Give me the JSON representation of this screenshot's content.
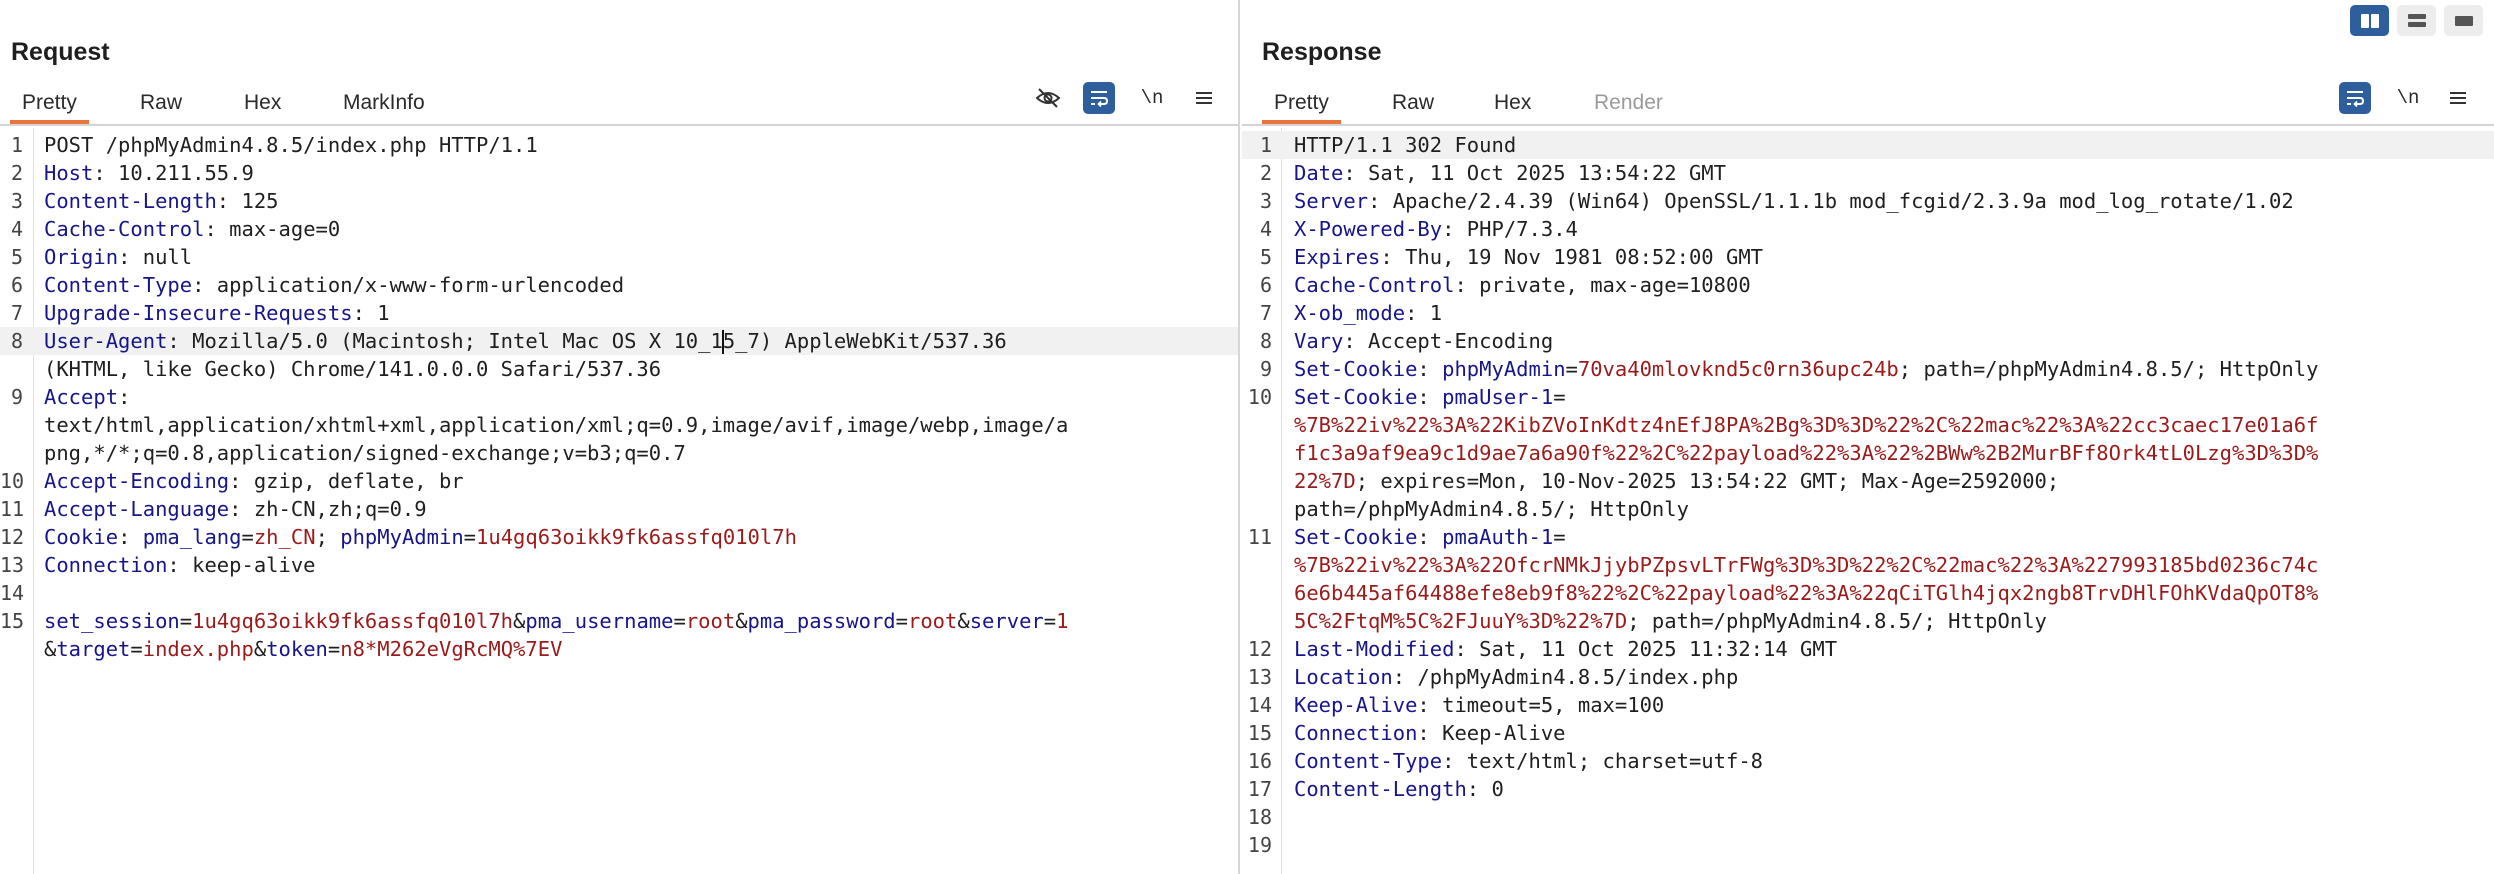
{
  "layout_switch": [
    "split-horizontal-icon",
    "split-vertical-icon",
    "tabs-view-icon"
  ],
  "request": {
    "title": "Request",
    "tabs": [
      "Pretty",
      "Raw",
      "Hex",
      "MarkInfo"
    ],
    "active_tab": "Pretty",
    "newline_toggle": "\\n",
    "lines": [
      {
        "n": "1",
        "segs": [
          {
            "t": "POST /phpMyAdmin4.8.5/index.php HTTP/1.1",
            "c": ""
          }
        ]
      },
      {
        "n": "2",
        "segs": [
          {
            "t": "Host",
            "c": "k"
          },
          {
            "t": ": 10.211.55.9",
            "c": ""
          }
        ]
      },
      {
        "n": "3",
        "segs": [
          {
            "t": "Content-Length",
            "c": "k"
          },
          {
            "t": ": 125",
            "c": ""
          }
        ]
      },
      {
        "n": "4",
        "segs": [
          {
            "t": "Cache-Control",
            "c": "k"
          },
          {
            "t": ": max-age=0",
            "c": ""
          }
        ]
      },
      {
        "n": "5",
        "segs": [
          {
            "t": "Origin",
            "c": "k"
          },
          {
            "t": ": null",
            "c": ""
          }
        ]
      },
      {
        "n": "6",
        "segs": [
          {
            "t": "Content-Type",
            "c": "k"
          },
          {
            "t": ": application/x-www-form-urlencoded",
            "c": ""
          }
        ]
      },
      {
        "n": "7",
        "segs": [
          {
            "t": "Upgrade-Insecure-Requests",
            "c": "k"
          },
          {
            "t": ": 1",
            "c": ""
          }
        ]
      },
      {
        "n": "8",
        "hl": true,
        "segs": [
          {
            "t": "User-Agent",
            "c": "k"
          },
          {
            "t": ": Mozilla/5.0 (Macintosh; Intel Mac OS X 10_1",
            "c": ""
          },
          {
            "caret": true
          },
          {
            "t": "5_7) AppleWebKit/537.36",
            "c": ""
          }
        ]
      },
      {
        "n": "",
        "segs": [
          {
            "t": "(KHTML, like Gecko) Chrome/141.0.0.0 Safari/537.36",
            "c": ""
          }
        ]
      },
      {
        "n": "9",
        "segs": [
          {
            "t": "Accept",
            "c": "k"
          },
          {
            "t": ":",
            "c": ""
          }
        ]
      },
      {
        "n": "",
        "segs": [
          {
            "t": "text/html,application/xhtml+xml,application/xml;q=0.9,image/avif,image/webp,image/a",
            "c": ""
          }
        ]
      },
      {
        "n": "",
        "segs": [
          {
            "t": "png,*/*;q=0.8,application/signed-exchange;v=b3;q=0.7",
            "c": ""
          }
        ]
      },
      {
        "n": "10",
        "segs": [
          {
            "t": "Accept-Encoding",
            "c": "k"
          },
          {
            "t": ": gzip, deflate, br",
            "c": ""
          }
        ]
      },
      {
        "n": "11",
        "segs": [
          {
            "t": "Accept-Language",
            "c": "k"
          },
          {
            "t": ": zh-CN,zh;q=0.9",
            "c": ""
          }
        ]
      },
      {
        "n": "12",
        "segs": [
          {
            "t": "Cookie",
            "c": "k"
          },
          {
            "t": ": ",
            "c": ""
          },
          {
            "t": "pma_lang",
            "c": "k"
          },
          {
            "t": "=",
            "c": ""
          },
          {
            "t": "zh_CN",
            "c": "v"
          },
          {
            "t": "; ",
            "c": ""
          },
          {
            "t": "phpMyAdmin",
            "c": "k"
          },
          {
            "t": "=",
            "c": ""
          },
          {
            "t": "1u4gq63oikk9fk6assfq010l7h",
            "c": "v"
          }
        ]
      },
      {
        "n": "13",
        "segs": [
          {
            "t": "Connection",
            "c": "k"
          },
          {
            "t": ": keep-alive",
            "c": ""
          }
        ]
      },
      {
        "n": "14",
        "segs": []
      },
      {
        "n": "15",
        "segs": [
          {
            "t": "set_session",
            "c": "k"
          },
          {
            "t": "=",
            "c": ""
          },
          {
            "t": "1u4gq63oikk9fk6assfq010l7h",
            "c": "v"
          },
          {
            "t": "&",
            "c": ""
          },
          {
            "t": "pma_username",
            "c": "k"
          },
          {
            "t": "=",
            "c": ""
          },
          {
            "t": "root",
            "c": "v"
          },
          {
            "t": "&",
            "c": ""
          },
          {
            "t": "pma_password",
            "c": "k"
          },
          {
            "t": "=",
            "c": ""
          },
          {
            "t": "root",
            "c": "v"
          },
          {
            "t": "&",
            "c": ""
          },
          {
            "t": "server",
            "c": "k"
          },
          {
            "t": "=",
            "c": ""
          },
          {
            "t": "1",
            "c": "v"
          }
        ]
      },
      {
        "n": "",
        "segs": [
          {
            "t": "&",
            "c": ""
          },
          {
            "t": "target",
            "c": "k"
          },
          {
            "t": "=",
            "c": ""
          },
          {
            "t": "index.php",
            "c": "v"
          },
          {
            "t": "&",
            "c": ""
          },
          {
            "t": "token",
            "c": "k"
          },
          {
            "t": "=",
            "c": ""
          },
          {
            "t": "n8*M262eVgRcMQ%7EV",
            "c": "v"
          }
        ]
      }
    ]
  },
  "response": {
    "title": "Response",
    "tabs": [
      "Pretty",
      "Raw",
      "Hex",
      "Render"
    ],
    "active_tab": "Pretty",
    "disabled_tab": "Render",
    "newline_toggle": "\\n",
    "lines": [
      {
        "n": "1",
        "hl": true,
        "segs": [
          {
            "t": "HTTP/1.1 302 Found",
            "c": ""
          }
        ]
      },
      {
        "n": "2",
        "segs": [
          {
            "t": "Date",
            "c": "k"
          },
          {
            "t": ": Sat, 11 Oct 2025 13:54:22 GMT",
            "c": ""
          }
        ]
      },
      {
        "n": "3",
        "segs": [
          {
            "t": "Server",
            "c": "k"
          },
          {
            "t": ": Apache/2.4.39 (Win64) OpenSSL/1.1.1b mod_fcgid/2.3.9a mod_log_rotate/1.02",
            "c": ""
          }
        ]
      },
      {
        "n": "4",
        "segs": [
          {
            "t": "X-Powered-By",
            "c": "k"
          },
          {
            "t": ": PHP/7.3.4",
            "c": ""
          }
        ]
      },
      {
        "n": "5",
        "segs": [
          {
            "t": "Expires",
            "c": "k"
          },
          {
            "t": ": Thu, 19 Nov 1981 08:52:00 GMT",
            "c": ""
          }
        ]
      },
      {
        "n": "6",
        "segs": [
          {
            "t": "Cache-Control",
            "c": "k"
          },
          {
            "t": ": private, max-age=10800",
            "c": ""
          }
        ]
      },
      {
        "n": "7",
        "segs": [
          {
            "t": "X-ob_mode",
            "c": "k"
          },
          {
            "t": ": 1",
            "c": ""
          }
        ]
      },
      {
        "n": "8",
        "segs": [
          {
            "t": "Vary",
            "c": "k"
          },
          {
            "t": ": Accept-Encoding",
            "c": ""
          }
        ]
      },
      {
        "n": "9",
        "segs": [
          {
            "t": "Set-Cookie",
            "c": "k"
          },
          {
            "t": ": ",
            "c": ""
          },
          {
            "t": "phpMyAdmin",
            "c": "k"
          },
          {
            "t": "=",
            "c": ""
          },
          {
            "t": "70va40mlovknd5c0rn36upc24b",
            "c": "v"
          },
          {
            "t": "; path=/phpMyAdmin4.8.5/; HttpOnly",
            "c": ""
          }
        ]
      },
      {
        "n": "10",
        "segs": [
          {
            "t": "Set-Cookie",
            "c": "k"
          },
          {
            "t": ": ",
            "c": ""
          },
          {
            "t": "pmaUser-1",
            "c": "k"
          },
          {
            "t": "=",
            "c": ""
          }
        ]
      },
      {
        "n": "",
        "segs": [
          {
            "t": "%7B%22iv%22%3A%22KibZVoInKdtz4nEfJ8PA%2Bg%3D%3D%22%2C%22mac%22%3A%22cc3caec17e01a6f",
            "c": "v"
          }
        ]
      },
      {
        "n": "",
        "segs": [
          {
            "t": "f1c3a9af9ea9c1d9ae7a6a90f%22%2C%22payload%22%3A%22%2BWw%2B2MurBFf8Ork4tL0Lzg%3D%3D%",
            "c": "v"
          }
        ]
      },
      {
        "n": "",
        "segs": [
          {
            "t": "22%7D",
            "c": "v"
          },
          {
            "t": "; expires=Mon, 10-Nov-2025 13:54:22 GMT; Max-Age=2592000;",
            "c": ""
          }
        ]
      },
      {
        "n": "",
        "segs": [
          {
            "t": "path=/phpMyAdmin4.8.5/; HttpOnly",
            "c": ""
          }
        ]
      },
      {
        "n": "11",
        "segs": [
          {
            "t": "Set-Cookie",
            "c": "k"
          },
          {
            "t": ": ",
            "c": ""
          },
          {
            "t": "pmaAuth-1",
            "c": "k"
          },
          {
            "t": "=",
            "c": ""
          }
        ]
      },
      {
        "n": "",
        "segs": [
          {
            "t": "%7B%22iv%22%3A%22OfcrNMkJjybPZpsvLTrFWg%3D%3D%22%2C%22mac%22%3A%227993185bd0236c74c",
            "c": "v"
          }
        ]
      },
      {
        "n": "",
        "segs": [
          {
            "t": "6e6b445af64488efe8eb9f8%22%2C%22payload%22%3A%22qCiTGlh4jqx2ngb8TrvDHlFOhKVdaQpOT8%",
            "c": "v"
          }
        ]
      },
      {
        "n": "",
        "segs": [
          {
            "t": "5C%2FtqM%5C%2FJuuY%3D%22%7D",
            "c": "v"
          },
          {
            "t": "; path=/phpMyAdmin4.8.5/; HttpOnly",
            "c": ""
          }
        ]
      },
      {
        "n": "12",
        "segs": [
          {
            "t": "Last-Modified",
            "c": "k"
          },
          {
            "t": ": Sat, 11 Oct 2025 11:32:14 GMT",
            "c": ""
          }
        ]
      },
      {
        "n": "13",
        "segs": [
          {
            "t": "Location",
            "c": "k"
          },
          {
            "t": ": /phpMyAdmin4.8.5/index.php",
            "c": ""
          }
        ]
      },
      {
        "n": "14",
        "segs": [
          {
            "t": "Keep-Alive",
            "c": "k"
          },
          {
            "t": ": timeout=5, max=100",
            "c": ""
          }
        ]
      },
      {
        "n": "15",
        "segs": [
          {
            "t": "Connection",
            "c": "k"
          },
          {
            "t": ": Keep-Alive",
            "c": ""
          }
        ]
      },
      {
        "n": "16",
        "segs": [
          {
            "t": "Content-Type",
            "c": "k"
          },
          {
            "t": ": text/html; charset=utf-8",
            "c": ""
          }
        ]
      },
      {
        "n": "17",
        "segs": [
          {
            "t": "Content-Length",
            "c": "k"
          },
          {
            "t": ": 0",
            "c": ""
          }
        ]
      },
      {
        "n": "18",
        "segs": []
      },
      {
        "n": "19",
        "segs": []
      }
    ]
  },
  "colors": {
    "accent_blue": "#2e5e9c",
    "tab_underline": "#e8743b",
    "header_name": "#16168a",
    "value_red": "#9b1b1b"
  }
}
